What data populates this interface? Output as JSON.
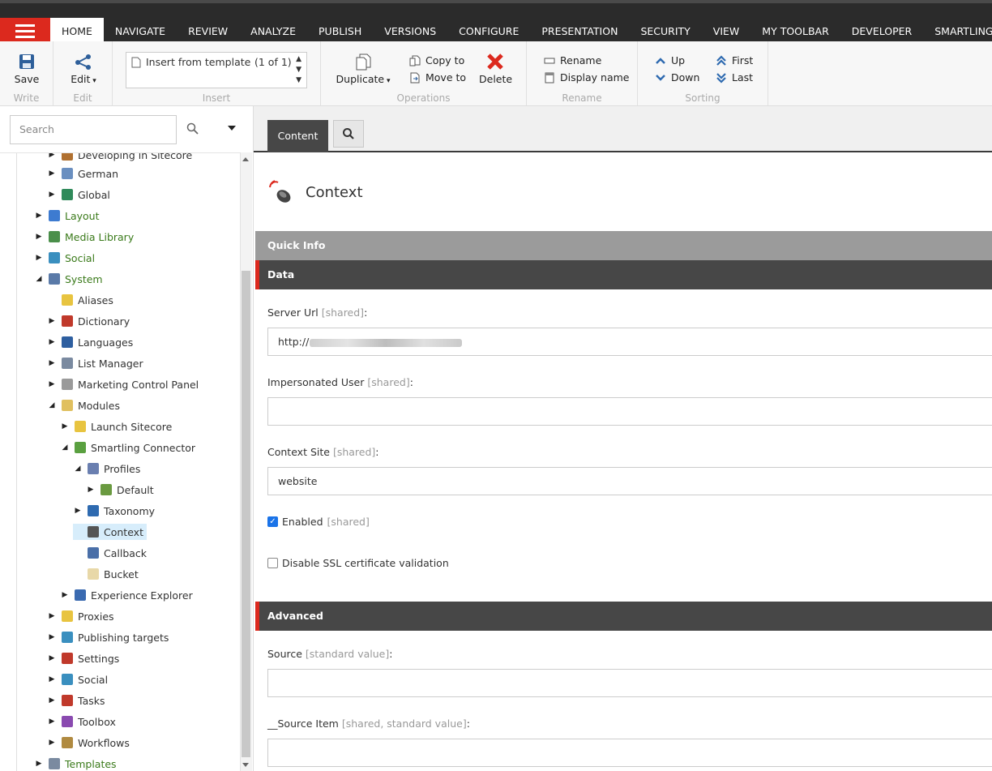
{
  "tabs": [
    "HOME",
    "NAVIGATE",
    "REVIEW",
    "ANALYZE",
    "PUBLISH",
    "VERSIONS",
    "CONFIGURE",
    "PRESENTATION",
    "SECURITY",
    "VIEW",
    "MY TOOLBAR",
    "DEVELOPER",
    "SMARTLING"
  ],
  "ribbon": {
    "save": "Save",
    "write": "Write",
    "edit": "Edit",
    "edit_group": "Edit",
    "insert_item": "Insert from template",
    "insert_count": "(1 of 1)",
    "insert_group": "Insert",
    "duplicate": "Duplicate",
    "copy_to": "Copy to",
    "move_to": "Move to",
    "delete": "Delete",
    "operations_group": "Operations",
    "rename": "Rename",
    "display_name": "Display name",
    "rename_group": "Rename",
    "up": "Up",
    "down": "Down",
    "first": "First",
    "last": "Last",
    "sorting_group": "Sorting"
  },
  "search": {
    "placeholder": "Search"
  },
  "tree": [
    {
      "label": "Developing in Sitecore",
      "color": "#b07030",
      "green": false
    },
    {
      "label": "German",
      "color": "#6a8fc0",
      "green": false
    },
    {
      "label": "Global",
      "color": "#2f8a5a",
      "green": false
    },
    {
      "label": "Layout",
      "color": "#3d7bd0",
      "green": true
    },
    {
      "label": "Media Library",
      "color": "#4a8f4a",
      "green": true
    },
    {
      "label": "Social",
      "color": "#3a8fbf",
      "green": true
    },
    {
      "label": "System",
      "color": "#5a7aa8",
      "green": true
    },
    {
      "label": "Aliases",
      "color": "#e8c440",
      "green": false
    },
    {
      "label": "Dictionary",
      "color": "#c0392b",
      "green": false
    },
    {
      "label": "Languages",
      "color": "#2e5fa0",
      "green": false
    },
    {
      "label": "List Manager",
      "color": "#7a8aa0",
      "green": false
    },
    {
      "label": "Marketing Control Panel",
      "color": "#9a9a9a",
      "green": false
    },
    {
      "label": "Modules",
      "color": "#e0c060",
      "green": false
    },
    {
      "label": "Launch Sitecore",
      "color": "#e8c440",
      "green": false
    },
    {
      "label": "Smartling Connector",
      "color": "#5aa040",
      "green": false
    },
    {
      "label": "Profiles",
      "color": "#6a7fb0",
      "green": false
    },
    {
      "label": "Default",
      "color": "#6a9a40",
      "green": false
    },
    {
      "label": "Taxonomy",
      "color": "#2e6ab0",
      "green": false
    },
    {
      "label": "Context",
      "color": "#555555",
      "green": false
    },
    {
      "label": "Callback",
      "color": "#4a6fa8",
      "green": false
    },
    {
      "label": "Bucket",
      "color": "#e8d8a8",
      "green": false
    },
    {
      "label": "Experience Explorer",
      "color": "#3a6ab0",
      "green": false
    },
    {
      "label": "Proxies",
      "color": "#e8c440",
      "green": false
    },
    {
      "label": "Publishing targets",
      "color": "#3a8fbf",
      "green": false
    },
    {
      "label": "Settings",
      "color": "#c0392b",
      "green": false
    },
    {
      "label": "Social",
      "color": "#3a8fbf",
      "green": false
    },
    {
      "label": "Tasks",
      "color": "#c0392b",
      "green": false
    },
    {
      "label": "Toolbox",
      "color": "#8a4ab0",
      "green": false
    },
    {
      "label": "Workflows",
      "color": "#b08a40",
      "green": false
    },
    {
      "label": "Templates",
      "color": "#7a8aa0",
      "green": true
    }
  ],
  "content": {
    "tab_content": "Content",
    "item_title": "Context",
    "quick_info": "Quick Info",
    "data_section": "Data",
    "server_url_label": "Server Url",
    "server_url_value": "http://",
    "impersonated_label": "Impersonated User",
    "context_site_label": "Context Site",
    "context_site_value": "website",
    "enabled_label": "Enabled",
    "disable_ssl_label": "Disable SSL certificate validation",
    "advanced_section": "Advanced",
    "source_label": "Source",
    "source_item_label": "__Source Item",
    "shared": "[shared]",
    "standard_value": "[standard value]",
    "shared_standard": "[shared, standard value]"
  },
  "colors": {
    "accent": "#dc291e",
    "topbar": "#2b2b2b",
    "section": "#474747"
  }
}
